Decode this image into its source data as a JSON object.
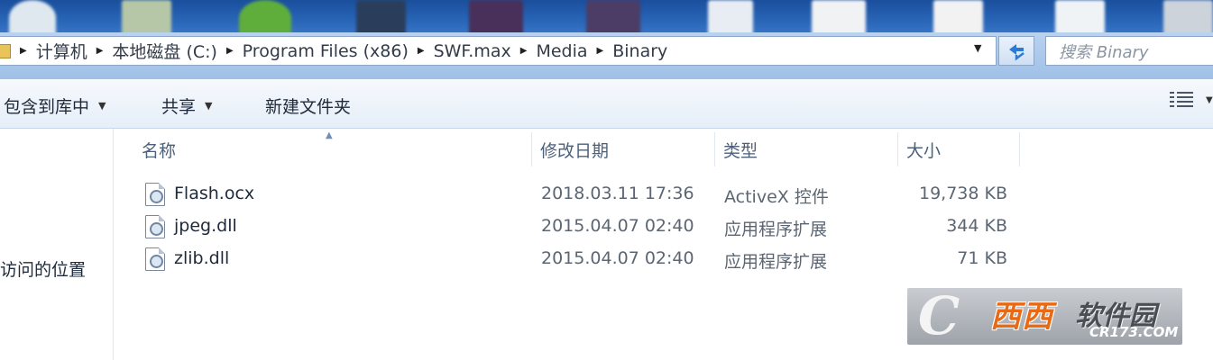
{
  "address_bar": {
    "breadcrumbs": [
      "计算机",
      "本地磁盘 (C:)",
      "Program Files (x86)",
      "SWF.max",
      "Media",
      "Binary"
    ]
  },
  "search": {
    "placeholder": "搜索 Binary"
  },
  "toolbar": {
    "include_in_library": "包含到库中",
    "share": "共享",
    "new_folder": "新建文件夹"
  },
  "nav_pane": {
    "partial_item": "访问的位置"
  },
  "columns": {
    "name": "名称",
    "modified": "修改日期",
    "type": "类型",
    "size": "大小"
  },
  "files": [
    {
      "name": "Flash.ocx",
      "modified": "2018.03.11 17:36",
      "type": "ActiveX 控件",
      "size": "19,738 KB"
    },
    {
      "name": "jpeg.dll",
      "modified": "2015.04.07 02:40",
      "type": "应用程序扩展",
      "size": "344 KB"
    },
    {
      "name": "zlib.dll",
      "modified": "2015.04.07 02:40",
      "type": "应用程序扩展",
      "size": "71 KB"
    }
  ],
  "watermark": {
    "letter": "C",
    "brand": "西西",
    "soft": "软件园",
    "url": "CR173.COM"
  },
  "icons": {
    "file": "dll-file-icon",
    "refresh": "refresh-icon",
    "view": "view-options-icon",
    "folder": "folder-icon"
  }
}
